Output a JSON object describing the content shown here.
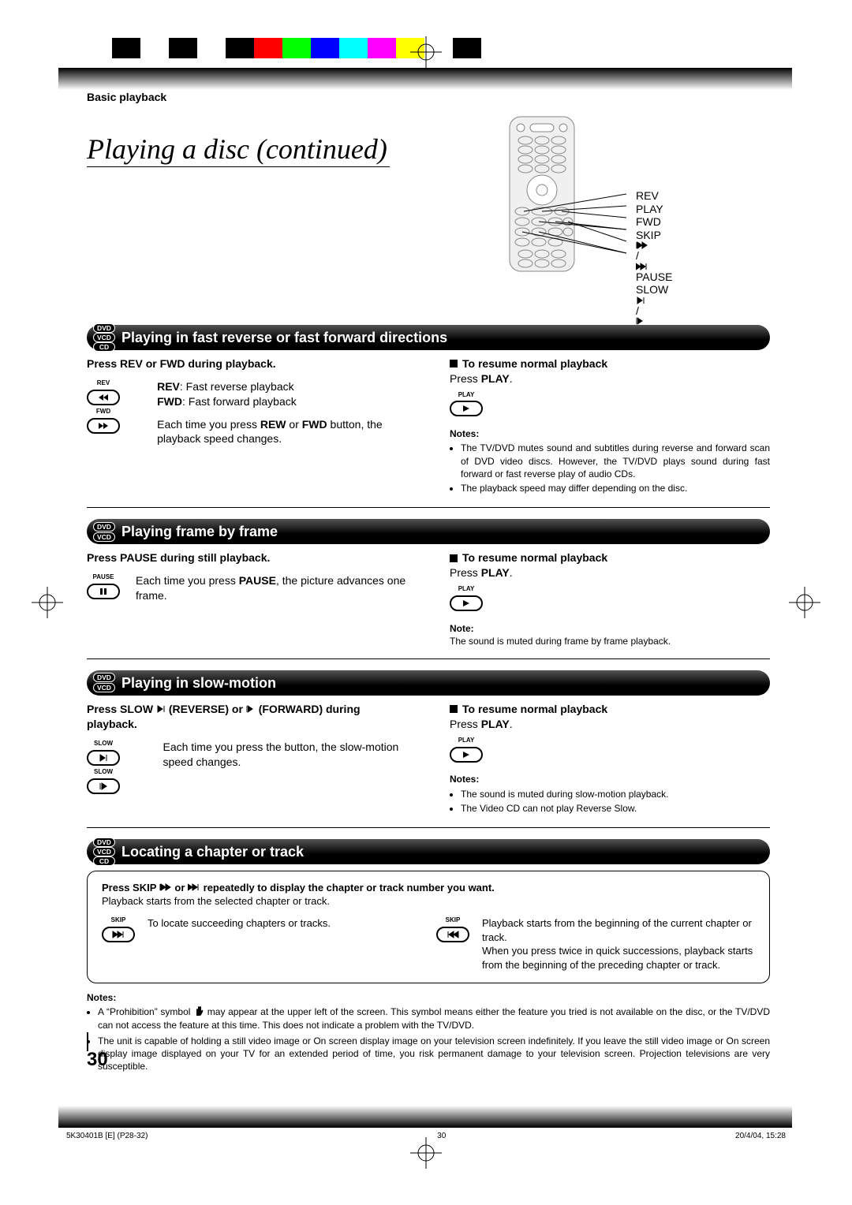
{
  "section_header": "Basic playback",
  "title": "Playing a disc (continued)",
  "remote_labels": {
    "rev": "REV",
    "play": "PLAY",
    "fwd": "FWD",
    "skip": "SKIP",
    "pause": "PAUSE",
    "slow": "SLOW"
  },
  "sections": {
    "s1": {
      "badges": [
        "DVD",
        "VCD",
        "CD"
      ],
      "title": "Playing in fast reverse or fast forward directions",
      "instr": "Press REV or FWD during playback.",
      "btn1": "REV",
      "btn2": "FWD",
      "rev_lbl": "REV",
      "rev_desc": ": Fast reverse playback",
      "fwd_lbl": "FWD",
      "fwd_desc": ": Fast forward playback",
      "para1a": "Each time you press ",
      "para1b": "REW",
      "para1c": " or ",
      "para1d": "FWD",
      "para1e": " button, the playback speed changes.",
      "resume_hdr": "To resume normal playback",
      "resume_a": "Press ",
      "resume_b": "PLAY",
      "resume_c": ".",
      "play_btn_label": "PLAY",
      "notes_hdr": "Notes:",
      "note1": "The TV/DVD mutes sound and subtitles during reverse and forward scan of DVD video discs. However, the TV/DVD plays sound during fast forward or fast reverse play of audio CDs.",
      "note2": "The playback speed may differ depending on the disc."
    },
    "s2": {
      "badges": [
        "DVD",
        "VCD"
      ],
      "title": "Playing frame by frame",
      "instr": "Press PAUSE during still playback.",
      "btn1": "PAUSE",
      "para_a": "Each time you press ",
      "para_b": "PAUSE",
      "para_c": ", the picture advances one frame.",
      "resume_hdr": "To resume normal playback",
      "resume_a": "Press ",
      "resume_b": "PLAY",
      "resume_c": ".",
      "play_btn_label": "PLAY",
      "notes_hdr": "Note:",
      "note1": "The sound is muted during frame by frame playback."
    },
    "s3": {
      "badges": [
        "DVD",
        "VCD"
      ],
      "title": "Playing in slow-motion",
      "instr_a": "Press SLOW ",
      "instr_b": "(REVERSE) or",
      "instr_c": "(FORWARD) during playback.",
      "btn1": "SLOW",
      "btn2": "SLOW",
      "para": "Each time you press the button, the slow-motion speed changes.",
      "resume_hdr": "To resume normal playback",
      "resume_a": "Press ",
      "resume_b": "PLAY",
      "resume_c": ".",
      "play_btn_label": "PLAY",
      "notes_hdr": "Notes:",
      "note1": "The sound is muted during slow-motion playback.",
      "note2": "The Video CD can not play Reverse Slow."
    },
    "s4": {
      "badges": [
        "DVD",
        "VCD",
        "CD"
      ],
      "title": "Locating a chapter or track",
      "instr_a": "Press SKIP ",
      "instr_b": " or ",
      "instr_c": " repeatedly to display the chapter or track number you want.",
      "sub": "Playback starts from the selected chapter or track.",
      "skip_label": "SKIP",
      "left_text": "To locate succeeding chapters or tracks.",
      "right_text": "Playback starts from the beginning of the current chapter or track.\nWhen you press twice in quick successions, playback starts from the beginning of the preceding chapter or track."
    }
  },
  "foot_notes": {
    "hdr": "Notes:",
    "n1a": "A “Prohibition” symbol ",
    "n1b": " may appear at the upper left of the screen. This symbol means either the feature you tried is not available on the disc, or the TV/DVD can not access the feature at this time. This does not indicate a problem with the TV/DVD.",
    "n2": "The unit is capable of holding a still video image or On screen display image on your television screen indefinitely. If you leave the still video image or On screen display image displayed on your TV for an extended period of time, you risk permanent damage to your television screen. Projection televisions are very susceptible."
  },
  "page_number": "30",
  "footer": {
    "left": "5K30401B [E] (P28-32)",
    "center": "30",
    "right": "20/4/04, 15:28"
  },
  "colorbar": [
    "#fff",
    "#000",
    "#fff",
    "#000",
    "#fff",
    "#000",
    "#f00",
    "#0f0",
    "#00f",
    "#0ff",
    "#f0f",
    "#ff0",
    "#fff",
    "#000"
  ]
}
